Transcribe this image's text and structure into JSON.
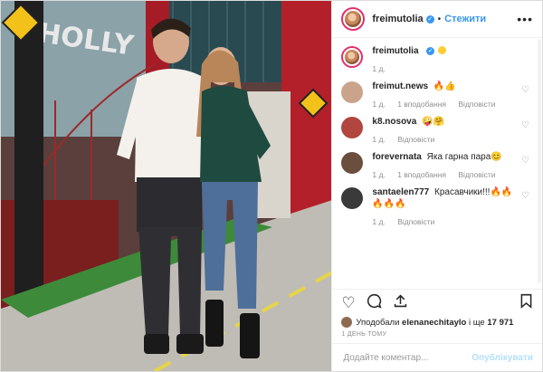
{
  "header": {
    "username": "freimutolia",
    "verified_mark": "✓",
    "separator": "•",
    "follow_label": "Стежити",
    "more_label": "•••"
  },
  "caption": {
    "username": "freimutolia",
    "time": "1 д."
  },
  "comments": [
    {
      "username": "freimut.news",
      "text": "🔥👍",
      "time": "1 д.",
      "likes": "1 вподобання",
      "reply": "Відповісти",
      "avatar_color": "#c9a48a"
    },
    {
      "username": "k8.nosova",
      "text": "🤪🤗",
      "time": "1 д.",
      "likes": "",
      "reply": "Відповісти",
      "avatar_color": "#b0463e"
    },
    {
      "username": "forevernata",
      "text": "Яка гарна пара😊",
      "time": "1 д.",
      "likes": "1 вподобання",
      "reply": "Відповісти",
      "avatar_color": "#6b4e3d"
    },
    {
      "username": "santaelen777",
      "text": "Красавчики!!!🔥🔥 🔥🔥🔥",
      "time": "1 д.",
      "likes": "",
      "reply": "Відповісти",
      "avatar_color": "#3a3a3a"
    }
  ],
  "actions": {
    "like_icon": "heart-icon",
    "comment_icon": "comment-icon",
    "share_icon": "share-icon",
    "save_icon": "bookmark-icon"
  },
  "likes": {
    "prefix": "Уподобали",
    "user": "elenanechitaylo",
    "and": "і ще",
    "count": "17 971"
  },
  "timestamp": "1 ДЕНЬ ТОМУ",
  "add_comment": {
    "placeholder": "Додайте коментар...",
    "post_label": "Опублікувати"
  },
  "colors": {
    "accent": "#3897f0",
    "story_ring": "#e1306c",
    "post_disabled": "#b2dffc"
  }
}
